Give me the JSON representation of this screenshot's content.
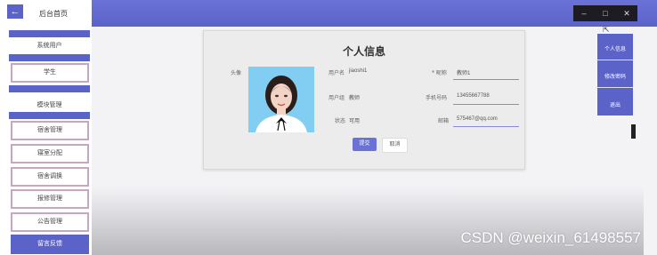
{
  "header": {
    "back_icon": "←",
    "brand": "后台首页",
    "window_controls": [
      "–",
      "□",
      "✕"
    ]
  },
  "sidebar": {
    "items": [
      {
        "label": "系统用户"
      },
      {
        "label": "学生"
      },
      {
        "label": "模块管理"
      },
      {
        "label": "宿舍管理"
      },
      {
        "label": "寝室分配"
      },
      {
        "label": "宿舍调换"
      },
      {
        "label": "报修管理"
      },
      {
        "label": "公告管理"
      },
      {
        "label": "留言反馈"
      }
    ]
  },
  "profile": {
    "title": "个人信息",
    "avatar_label": "头像",
    "username_label": "用户名",
    "username_value": "jiaoshi1",
    "group_label": "用户组",
    "group_value": "教师",
    "status_label": "状态",
    "status_value": "可用",
    "nickname_label": "* 昵称",
    "nickname_value": "教师1",
    "phone_label": "手机号码",
    "phone_value": "13455667788",
    "email_label": "邮箱",
    "email_value": "575467@qq.com",
    "submit_label": "提交",
    "cancel_label": "取消"
  },
  "right_menu": {
    "items": [
      "个人信息",
      "修改密码",
      "退出"
    ]
  },
  "watermark": "CSDN @weixin_61498557"
}
